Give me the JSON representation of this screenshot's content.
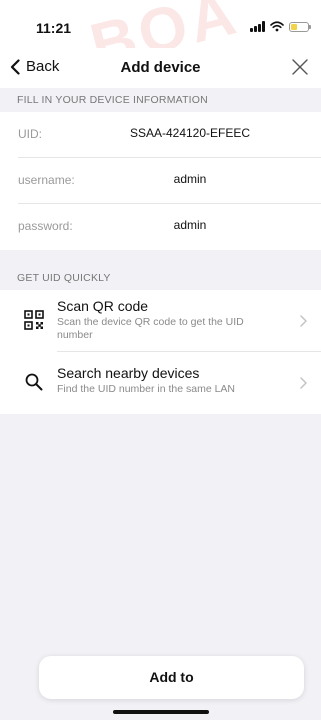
{
  "status_bar": {
    "time": "11:21",
    "signal_icon": "signal-bars-icon",
    "wifi_icon": "wifi-icon",
    "battery_icon": "battery-low-icon",
    "battery_level": 0.4,
    "battery_color": "#f1d44a"
  },
  "watermark": {
    "text": "BOA"
  },
  "nav": {
    "back_label": "Back",
    "title": "Add device",
    "close_icon": "close-icon"
  },
  "form": {
    "section_header": "FILL IN YOUR DEVICE INFORMATION",
    "rows": [
      {
        "label": "UID:",
        "value": "SSAA-424120-EFEEC"
      },
      {
        "label": "username:",
        "value": "admin"
      },
      {
        "label": "password:",
        "value": "admin"
      }
    ]
  },
  "quick": {
    "section_header": "GET UID QUICKLY",
    "items": [
      {
        "title": "Scan QR code",
        "description": "Scan the device QR code to get the UID number",
        "icon": "qr-code-icon"
      },
      {
        "title": "Search nearby devices",
        "description": "Find the UID number in the same LAN",
        "icon": "search-icon"
      }
    ]
  },
  "footer": {
    "add_label": "Add to"
  },
  "colors": {
    "background": "#f2f2f6",
    "surface": "#ffffff",
    "secondary_text": "#8a8a8a"
  }
}
